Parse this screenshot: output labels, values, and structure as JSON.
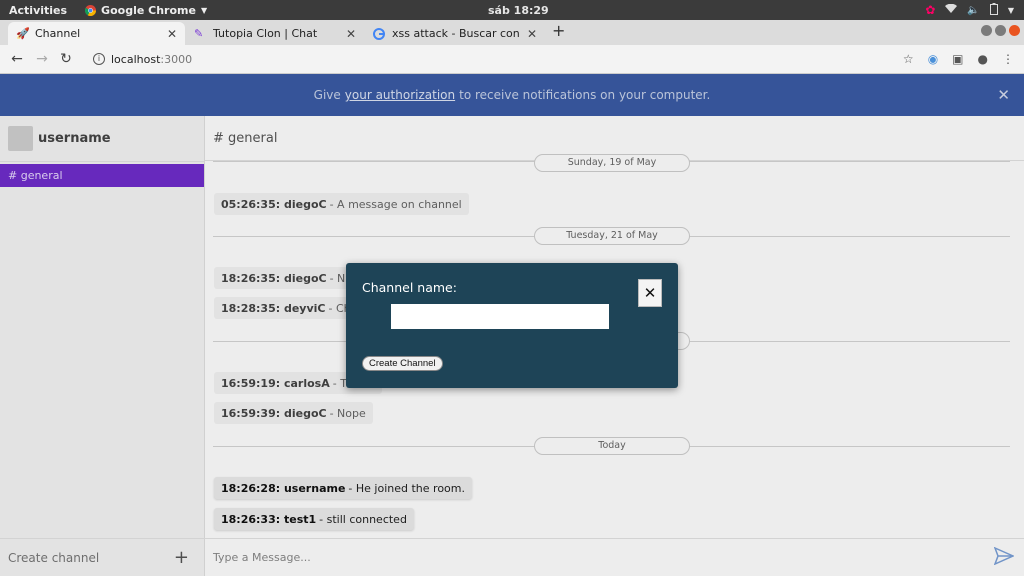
{
  "os": {
    "activities": "Activities",
    "app_name": "Google Chrome",
    "clock": "sáb 18:29"
  },
  "tabs": [
    {
      "title": "Channel",
      "close": "✕",
      "icon": "rocket-icon"
    },
    {
      "title": "Tutopia Clon | Chat",
      "close": "✕",
      "icon": "pencil-icon"
    },
    {
      "title": "xss attack - Buscar con Go",
      "close": "✕",
      "icon": "google-icon"
    }
  ],
  "address": {
    "host": "localhost",
    "port": ":3000"
  },
  "banner": {
    "pre": "Give",
    "link": "your authorization",
    "post": "to receive notifications on your computer."
  },
  "sidebar": {
    "username": "username",
    "channel": "# general",
    "create_channel": "Create channel"
  },
  "main": {
    "header": "# general",
    "dates": [
      "Sunday, 19 of May",
      "Tuesday, 21 of May",
      "Today"
    ],
    "messages": [
      {
        "time": "05:26:35:",
        "user": "diegoC",
        "text": "- A message on channel"
      },
      {
        "time": "18:26:35:",
        "user": "diegoC",
        "text": "- Nuevo"
      },
      {
        "time": "18:28:35:",
        "user": "deyviC",
        "text": "- Chifita?"
      },
      {
        "time": "16:59:19:",
        "user": "carlosA",
        "text": "- This is"
      },
      {
        "time": "16:59:39:",
        "user": "diegoC",
        "text": "- Nope"
      },
      {
        "time": "18:26:28:",
        "user": "username",
        "text": "- He joined the room."
      },
      {
        "time": "18:26:33:",
        "user": "test1",
        "text": "- still connected"
      }
    ],
    "composer_placeholder": "Type a Message..."
  },
  "modal": {
    "label": "Channel name:",
    "input_value": "",
    "close": "✕",
    "button": "Create Channel"
  }
}
